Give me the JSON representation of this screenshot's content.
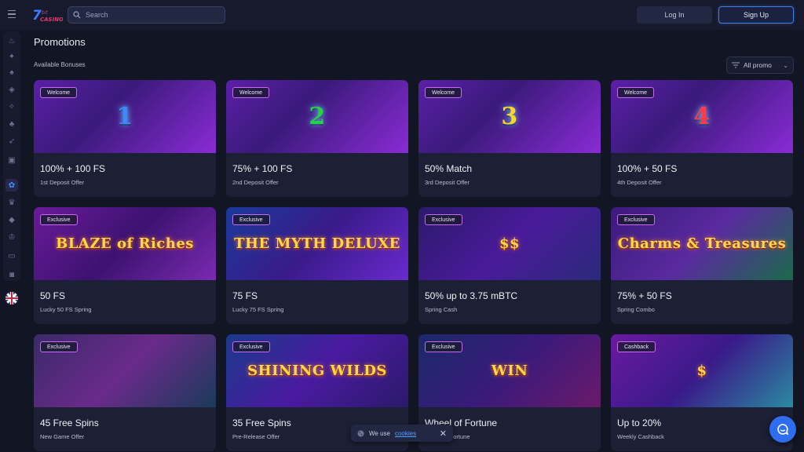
{
  "header": {
    "search_placeholder": "Search",
    "login_label": "Log In",
    "signup_label": "Sign Up",
    "logo_text": "7bit casino"
  },
  "sidebar": {
    "items": [
      "fire-icon",
      "bonus-icon",
      "hot-icon",
      "dice-icon",
      "live-icon",
      "clover-icon",
      "rocket-icon",
      "cards-icon",
      "gift-icon",
      "trophy-icon",
      "vip-icon",
      "crown-icon",
      "card-icon",
      "tournament-icon"
    ],
    "active": "gift-icon",
    "language_flag": "uk-flag-icon"
  },
  "main": {
    "title": "Promotions",
    "subtitle": "Available Bonuses",
    "filter_label": "All promo"
  },
  "promos": [
    {
      "badge": "Welcome",
      "title": "100% + 100 FS",
      "desc": "1st Deposit Offer",
      "art": "1"
    },
    {
      "badge": "Welcome",
      "title": "75% + 100 FS",
      "desc": "2nd Deposit Offer",
      "art": "2"
    },
    {
      "badge": "Welcome",
      "title": "50% Match",
      "desc": "3rd Deposit Offer",
      "art": "3"
    },
    {
      "badge": "Welcome",
      "title": "100% + 50 FS",
      "desc": "4th Deposit Offer",
      "art": "4"
    },
    {
      "badge": "Exclusive",
      "title": "50 FS",
      "desc": "Lucky 50 FS Spring",
      "art": "BLAZE of Riches"
    },
    {
      "badge": "Exclusive",
      "title": "75 FS",
      "desc": "Lucky 75 FS Spring",
      "art": "THE MYTH DELUXE"
    },
    {
      "badge": "Exclusive",
      "title": "50% up to 3.75 mBTC",
      "desc": "Spring Cash",
      "art": "$$"
    },
    {
      "badge": "Exclusive",
      "title": "75% + 50 FS",
      "desc": "Spring Combo",
      "art": "Charms & Treasures"
    },
    {
      "badge": "Exclusive",
      "title": "45 Free Spins",
      "desc": "New Game Offer",
      "art": ""
    },
    {
      "badge": "Exclusive",
      "title": "35 Free Spins",
      "desc": "Pre-Release Offer",
      "art": "SHINING WILDS"
    },
    {
      "badge": "Exclusive",
      "title": "Wheel of Fortune",
      "desc": "Wheel of Fortune",
      "art": "WIN"
    },
    {
      "badge": "Cashback",
      "title": "Up to 20%",
      "desc": "Weekly Cashback",
      "art": "$"
    }
  ],
  "cookie": {
    "text": "We use",
    "link": "cookies"
  },
  "colors": {
    "background": "#121524",
    "accent": "#3f7fe8",
    "badge_border": "#c56cf0"
  }
}
